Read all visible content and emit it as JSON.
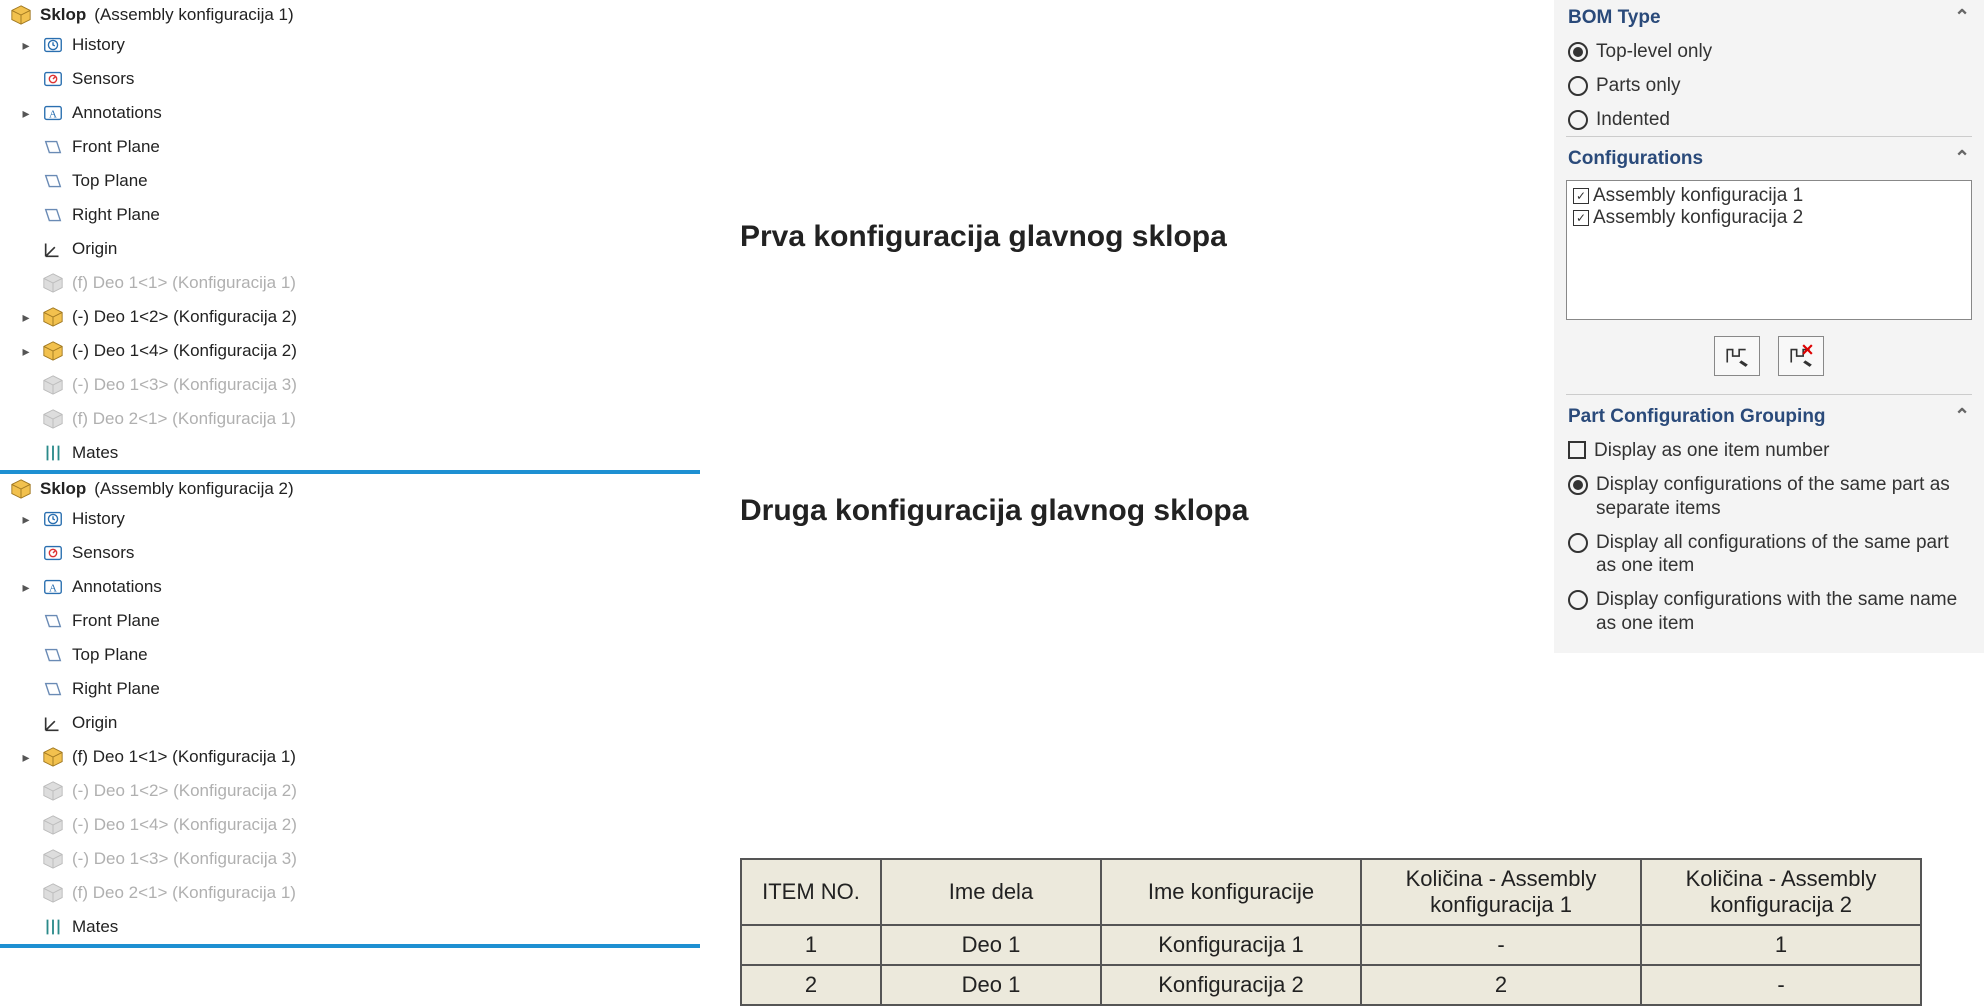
{
  "trees": [
    {
      "root_label": "Sklop",
      "root_cfg": "  (Assembly konfiguracija 1)",
      "items": [
        {
          "exp": "▸",
          "icon": "hist",
          "label": "History",
          "sup": false
        },
        {
          "exp": "",
          "icon": "sens",
          "label": "Sensors",
          "sup": false
        },
        {
          "exp": "▸",
          "icon": "ann",
          "label": "Annotations",
          "sup": false
        },
        {
          "exp": "",
          "icon": "plane",
          "label": "Front Plane",
          "sup": false
        },
        {
          "exp": "",
          "icon": "plane",
          "label": "Top Plane",
          "sup": false
        },
        {
          "exp": "",
          "icon": "plane",
          "label": "Right Plane",
          "sup": false
        },
        {
          "exp": "",
          "icon": "origin",
          "label": "Origin",
          "sup": false
        },
        {
          "exp": "",
          "icon": "part-s",
          "label": "(f) Deo 1<1> (Konfiguracija 1)",
          "sup": true
        },
        {
          "exp": "▸",
          "icon": "part",
          "label": "(-) Deo 1<2> (Konfiguracija 2)",
          "sup": false
        },
        {
          "exp": "▸",
          "icon": "part",
          "label": "(-) Deo 1<4> (Konfiguracija 2)",
          "sup": false
        },
        {
          "exp": "",
          "icon": "part-s",
          "label": "(-) Deo 1<3> (Konfiguracija 3)",
          "sup": true
        },
        {
          "exp": "",
          "icon": "part-s",
          "label": "(f) Deo 2<1> (Konfiguracija 1)",
          "sup": true
        },
        {
          "exp": "",
          "icon": "mates",
          "label": "Mates",
          "sup": false
        }
      ]
    },
    {
      "root_label": "Sklop",
      "root_cfg": "  (Assembly konfiguracija 2)",
      "items": [
        {
          "exp": "▸",
          "icon": "hist",
          "label": "History",
          "sup": false
        },
        {
          "exp": "",
          "icon": "sens",
          "label": "Sensors",
          "sup": false
        },
        {
          "exp": "▸",
          "icon": "ann",
          "label": "Annotations",
          "sup": false
        },
        {
          "exp": "",
          "icon": "plane",
          "label": "Front Plane",
          "sup": false
        },
        {
          "exp": "",
          "icon": "plane",
          "label": "Top Plane",
          "sup": false
        },
        {
          "exp": "",
          "icon": "plane",
          "label": "Right Plane",
          "sup": false
        },
        {
          "exp": "",
          "icon": "origin",
          "label": "Origin",
          "sup": false
        },
        {
          "exp": "▸",
          "icon": "part",
          "label": "(f) Deo 1<1> (Konfiguracija 1)",
          "sup": false
        },
        {
          "exp": "",
          "icon": "part-s",
          "label": "(-) Deo 1<2> (Konfiguracija 2)",
          "sup": true
        },
        {
          "exp": "",
          "icon": "part-s",
          "label": "(-) Deo 1<4> (Konfiguracija 2)",
          "sup": true
        },
        {
          "exp": "",
          "icon": "part-s",
          "label": "(-) Deo 1<3> (Konfiguracija 3)",
          "sup": true
        },
        {
          "exp": "",
          "icon": "part-s",
          "label": "(f) Deo 2<1> (Konfiguracija 1)",
          "sup": true
        },
        {
          "exp": "",
          "icon": "mates",
          "label": "Mates",
          "sup": false
        }
      ]
    }
  ],
  "center": {
    "heading1": "Prva konfiguracija glavnog sklopa",
    "heading2": "Druga konfiguracija glavnog sklopa"
  },
  "bom": {
    "headers": [
      "ITEM NO.",
      "Ime dela",
      "Ime konfiguracije",
      "Količina - Assembly konfiguracija 1",
      "Količina - Assembly konfiguracija 2"
    ],
    "rows": [
      [
        "1",
        "Deo 1",
        "Konfiguracija 1",
        "-",
        "1"
      ],
      [
        "2",
        "Deo 1",
        "Konfiguracija 2",
        "2",
        "-"
      ]
    ]
  },
  "right": {
    "bom_type": {
      "title": "BOM Type",
      "opt1": "Top-level only",
      "opt2": "Parts only",
      "opt3": "Indented"
    },
    "configs": {
      "title": "Configurations",
      "items": [
        "Assembly konfiguracija 1",
        "Assembly konfiguracija 2"
      ]
    },
    "grouping": {
      "title": "Part Configuration Grouping",
      "chk": "Display as one item number",
      "opt1": "Display configurations of the same part as separate items",
      "opt2": "Display all configurations of the same part as one item",
      "opt3": "Display configurations with the same name as one item"
    }
  }
}
